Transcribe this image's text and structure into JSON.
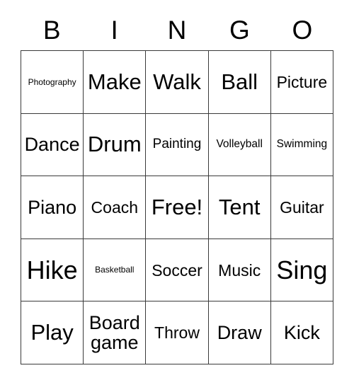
{
  "header": {
    "letters": [
      "B",
      "I",
      "N",
      "G",
      "O"
    ]
  },
  "grid": {
    "rows": [
      [
        {
          "label": "Photography",
          "size": "fs-xs"
        },
        {
          "label": "Make",
          "size": "fs-2xl"
        },
        {
          "label": "Walk",
          "size": "fs-2xl"
        },
        {
          "label": "Ball",
          "size": "fs-2xl"
        },
        {
          "label": "Picture",
          "size": "fs-lg"
        }
      ],
      [
        {
          "label": "Dance",
          "size": "fs-xl"
        },
        {
          "label": "Drum",
          "size": "fs-2xl"
        },
        {
          "label": "Painting",
          "size": "fs-md"
        },
        {
          "label": "Volleyball",
          "size": "fs-sm"
        },
        {
          "label": "Swimming",
          "size": "fs-sm"
        }
      ],
      [
        {
          "label": "Piano",
          "size": "fs-xl"
        },
        {
          "label": "Coach",
          "size": "fs-lg"
        },
        {
          "label": "Free!",
          "size": "fs-2xl"
        },
        {
          "label": "Tent",
          "size": "fs-2xl"
        },
        {
          "label": "Guitar",
          "size": "fs-lg"
        }
      ],
      [
        {
          "label": "Hike",
          "size": "fs-3xl"
        },
        {
          "label": "Basketball",
          "size": "fs-xs"
        },
        {
          "label": "Soccer",
          "size": "fs-lg"
        },
        {
          "label": "Music",
          "size": "fs-lg"
        },
        {
          "label": "Sing",
          "size": "fs-3xl"
        }
      ],
      [
        {
          "label": "Play",
          "size": "fs-2xl"
        },
        {
          "label": "Board\ngame",
          "size": "fs-xl"
        },
        {
          "label": "Throw",
          "size": "fs-lg"
        },
        {
          "label": "Draw",
          "size": "fs-xl"
        },
        {
          "label": "Kick",
          "size": "fs-xl"
        }
      ]
    ]
  },
  "colors": {
    "background": "#ffffff",
    "text": "#000000",
    "border": "#3a3a3a"
  }
}
